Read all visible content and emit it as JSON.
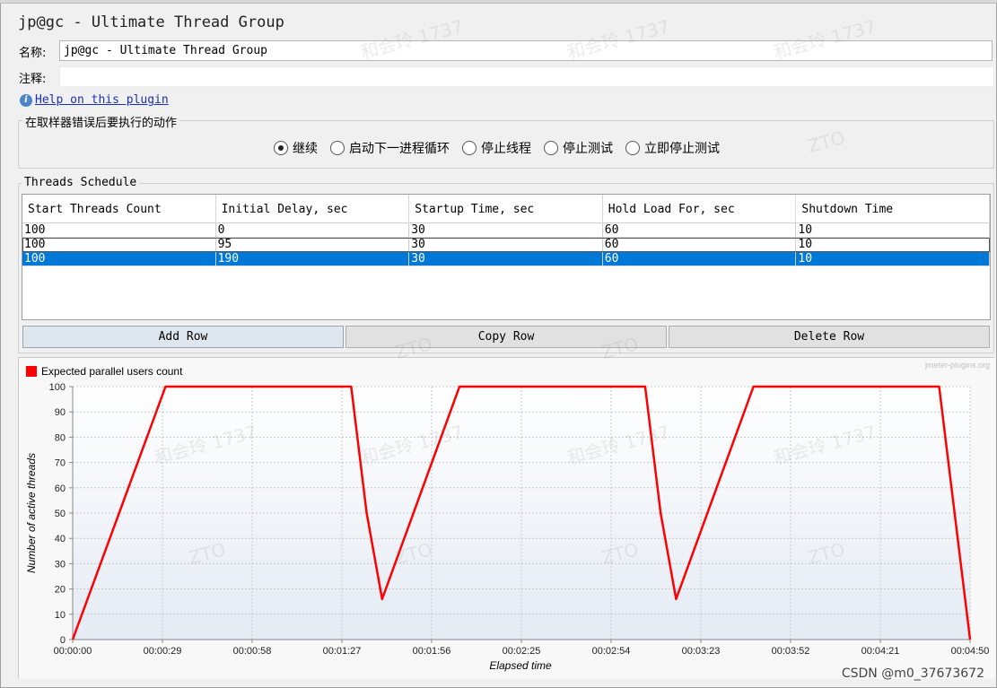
{
  "title": "jp@gc - Ultimate Thread Group",
  "name_field": {
    "label": "名称:",
    "value": "jp@gc - Ultimate Thread Group"
  },
  "comment_field": {
    "label": "注释:",
    "value": ""
  },
  "help": {
    "icon": "info-icon",
    "label": "Help on this plugin"
  },
  "error_action": {
    "title": "在取样器错误后要执行的动作",
    "options": [
      {
        "label": "继续",
        "selected": true
      },
      {
        "label": "启动下一进程循环",
        "selected": false
      },
      {
        "label": "停止线程",
        "selected": false
      },
      {
        "label": "停止测试",
        "selected": false
      },
      {
        "label": "立即停止测试",
        "selected": false
      }
    ]
  },
  "schedule": {
    "title": "Threads Schedule",
    "columns": [
      "Start Threads Count",
      "Initial Delay, sec",
      "Startup Time, sec",
      "Hold Load For, sec",
      "Shutdown Time"
    ],
    "rows": [
      [
        "100",
        "0",
        "30",
        "60",
        "10"
      ],
      [
        "100",
        "95",
        "30",
        "60",
        "10"
      ],
      [
        "100",
        "190",
        "30",
        "60",
        "10"
      ]
    ],
    "selected_row": 2,
    "buttons": {
      "add": "Add Row",
      "copy": "Copy Row",
      "delete": "Delete Row"
    }
  },
  "chart_data": {
    "type": "line",
    "legend": "Expected parallel users count",
    "legend_color": "#ff0000",
    "credit": "jmeter-plugins.org",
    "xlabel": "Elapsed time",
    "ylabel": "Number of active threads",
    "ylim": [
      0,
      100
    ],
    "y_ticks": [
      "0",
      "10",
      "20",
      "30",
      "40",
      "50",
      "60",
      "70",
      "80",
      "90",
      "100"
    ],
    "x_ticks": [
      "00:00:00",
      "00:00:29",
      "00:00:58",
      "00:01:27",
      "00:01:56",
      "00:02:25",
      "00:02:54",
      "00:03:23",
      "00:03:52",
      "00:04:21",
      "00:04:50"
    ],
    "xlim_seconds": [
      0,
      290
    ],
    "grid": true,
    "series": [
      {
        "name": "Expected parallel users count",
        "points": [
          [
            0,
            0
          ],
          [
            30,
            100
          ],
          [
            90,
            100
          ],
          [
            95,
            50
          ],
          [
            100,
            16
          ],
          [
            125,
            100
          ],
          [
            185,
            100
          ],
          [
            190,
            50
          ],
          [
            195,
            16
          ],
          [
            220,
            100
          ],
          [
            280,
            100
          ],
          [
            290,
            0
          ]
        ]
      }
    ]
  },
  "watermarks": {
    "name_text": "和会玲 1737",
    "code_text": "ZTO"
  },
  "footer": "CSDN @m0_37673672"
}
